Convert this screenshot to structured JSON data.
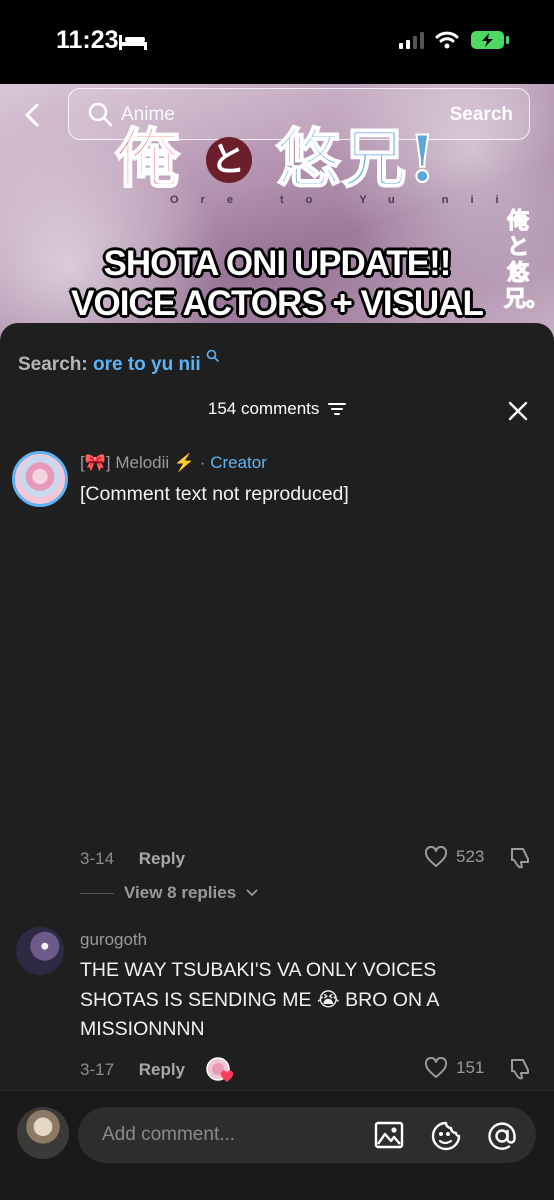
{
  "status": {
    "time": "11:23"
  },
  "hero": {
    "search_placeholder": "Anime",
    "search_action": "Search",
    "logo_part1": "俺",
    "logo_part2": "と",
    "logo_part3": "悠兄!",
    "romaji": "Ore to Yu nii",
    "side_text_1": "俺",
    "side_text_2": "と",
    "side_text_3": "悠兄。",
    "headline_1": "SHOTA ONI UPDATE!!",
    "headline_2": "VOICE ACTORS + VISUAL"
  },
  "sheet": {
    "search_prefix": "Search: ",
    "search_term": "ore to yu nii",
    "comments_count": "154 comments"
  },
  "comments": [
    {
      "author": "[🎀] Melodii ⚡️ ·",
      "badge": "Creator",
      "body": "[Comment text not reproduced]",
      "date": "3-14",
      "reply_label": "Reply",
      "likes": "523",
      "view_replies": "View 8 replies"
    },
    {
      "author": "gurogoth",
      "body": "THE WAY TSUBAKI'S VA ONLY VOICES SHOTAS IS SENDING ME 😭 BRO ON A MISSIONNNN",
      "date": "3-17",
      "reply_label": "Reply",
      "likes": "151"
    }
  ],
  "footer": {
    "placeholder": "Add comment..."
  },
  "colors": {
    "accent": "#5db4f5",
    "sheet": "#1f1f1f",
    "battery": "#4cd964"
  }
}
